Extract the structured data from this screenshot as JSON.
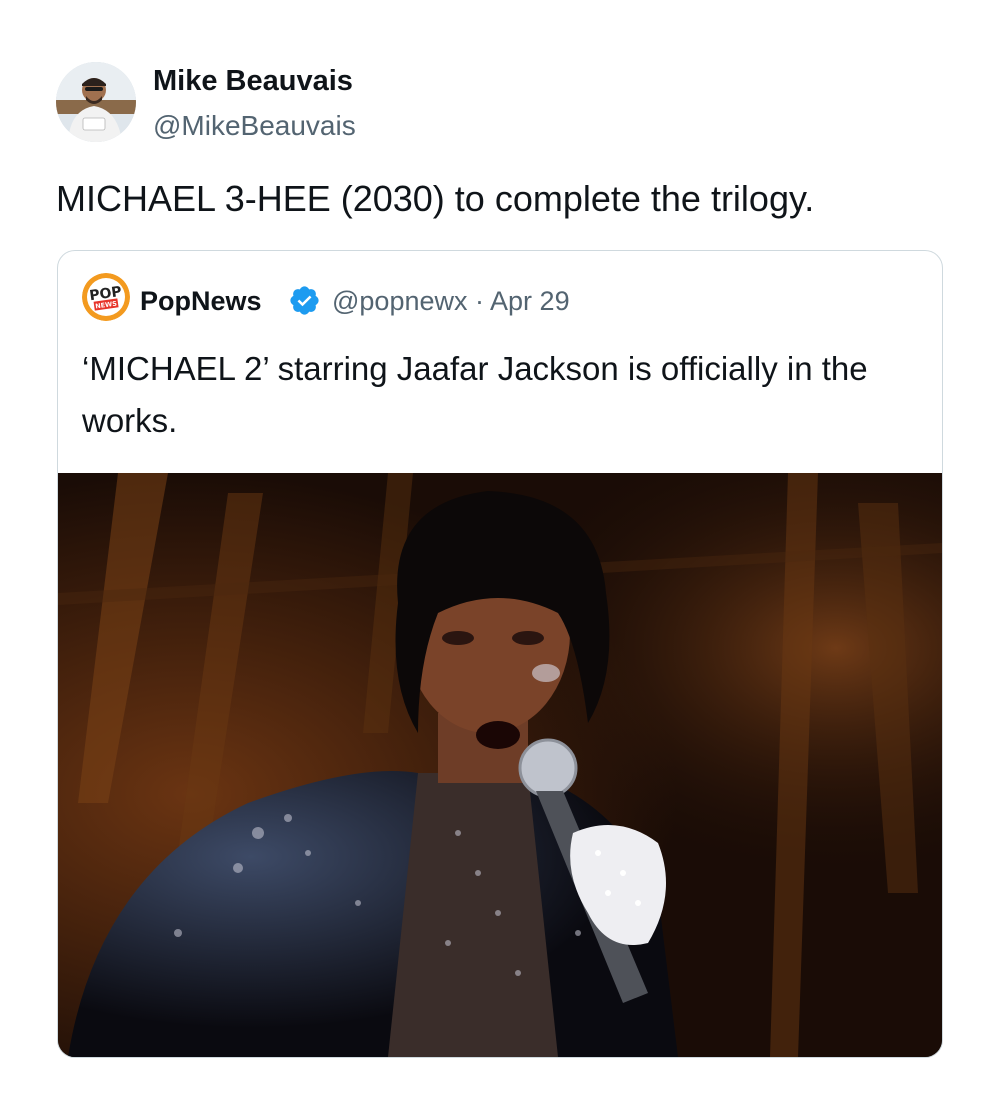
{
  "tweet": {
    "author": {
      "name": "Mike Beauvais",
      "handle": "@MikeBeauvais"
    },
    "text": "MICHAEL 3-HEE (2030) to complete the trilogy."
  },
  "quote": {
    "author": {
      "name": "PopNews",
      "handle": "@popnewx",
      "separator": "·",
      "date": "Apr 29",
      "logo_text_top": "POP",
      "logo_text_bottom": "NEWS"
    },
    "text": "‘MICHAEL 2’ starring Jaafar Jackson is officially in the works.",
    "media": {
      "icon": "photo-icon"
    }
  },
  "colors": {
    "text_primary": "#0f1419",
    "text_secondary": "#536471",
    "border": "#cfd9de",
    "verified": "#1d9bf0",
    "popnews_orange": "#f39a1f"
  }
}
